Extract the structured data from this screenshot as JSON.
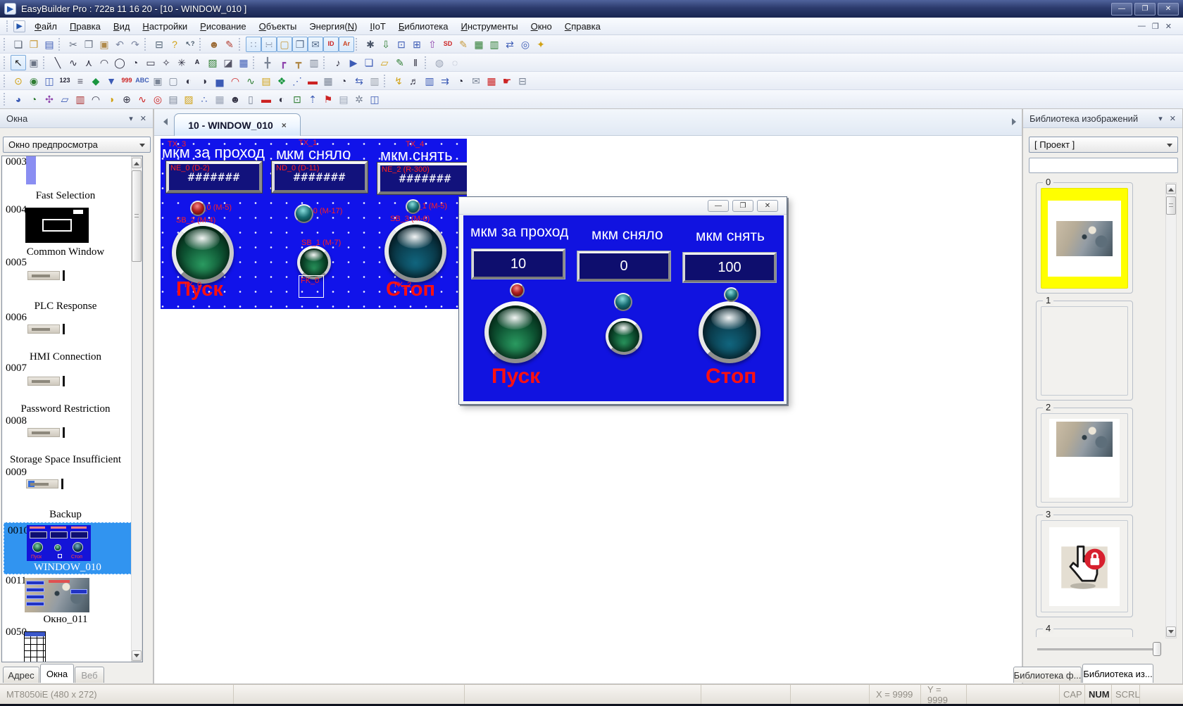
{
  "titlebar": {
    "title": "EasyBuilder Pro : 722в 11 16 20 - [10 - WINDOW_010 ]",
    "icon_glyph": "▶",
    "controls": [
      {
        "n": "minimize-button",
        "g": "—"
      },
      {
        "n": "maximize-button",
        "g": "❐"
      },
      {
        "n": "close-button",
        "g": "✕"
      }
    ]
  },
  "menu": {
    "items": [
      {
        "n": "menu-item-file",
        "label": "Файл",
        "u": 0
      },
      {
        "n": "menu-item-edit",
        "label": "Правка",
        "u": 0
      },
      {
        "n": "menu-item-view",
        "label": "Вид",
        "u": 0
      },
      {
        "n": "menu-item-options",
        "label": "Настройки",
        "u": 0
      },
      {
        "n": "menu-item-draw",
        "label": "Рисование",
        "u": 0
      },
      {
        "n": "menu-item-objects",
        "label": "Объекты",
        "u": 0
      },
      {
        "n": "menu-item-energy",
        "label": "Энергия(N)",
        "u": 8
      },
      {
        "n": "menu-item-iiot",
        "label": "IIoT",
        "u": 0
      },
      {
        "n": "menu-item-library",
        "label": "Библиотека",
        "u": 0
      },
      {
        "n": "menu-item-tools",
        "label": "Инструменты",
        "u": 0
      },
      {
        "n": "menu-item-window",
        "label": "Окно",
        "u": 0
      },
      {
        "n": "menu-item-help",
        "label": "Справка",
        "u": 0
      }
    ],
    "mdi": [
      {
        "n": "mdi-minimize-button",
        "g": "—"
      },
      {
        "n": "mdi-restore-button",
        "g": "❐"
      },
      {
        "n": "mdi-close-button",
        "g": "✕"
      }
    ]
  },
  "toolbars": {
    "row1": [
      {
        "n": "toolbar-grip",
        "g": "",
        "cls": "grip",
        "int": "false"
      },
      {
        "n": "new-button",
        "g": "❏",
        "c": "#555e6e"
      },
      {
        "n": "open-button",
        "g": "❒",
        "c": "#c79a3d"
      },
      {
        "n": "save-button",
        "g": "▤",
        "c": "#3c5bb5"
      },
      {
        "n": "toolbar-grip",
        "g": "",
        "cls": "grip",
        "int": "false"
      },
      {
        "n": "cut-button",
        "g": "✂",
        "c": "#6b7485"
      },
      {
        "n": "copy-button",
        "g": "❐",
        "c": "#6b7485"
      },
      {
        "n": "paste-button",
        "g": "▣",
        "c": "#b08a4a"
      },
      {
        "n": "undo-button",
        "g": "↶",
        "c": "#7b85a0"
      },
      {
        "n": "redo-button",
        "g": "↷",
        "c": "#7b85a0"
      },
      {
        "n": "toolbar-grip",
        "g": "",
        "cls": "grip",
        "int": "false"
      },
      {
        "n": "print-button",
        "g": "⊟",
        "c": "#556677"
      },
      {
        "n": "about-button",
        "g": "?",
        "c": "#d1a216"
      },
      {
        "n": "context-help-button",
        "g": "↖?",
        "c": "#445566",
        "cls": "txt"
      },
      {
        "n": "toolbar-grip",
        "g": "",
        "cls": "grip",
        "int": "false"
      },
      {
        "n": "easy-watch-button",
        "g": "☻",
        "c": "#9a6a35"
      },
      {
        "n": "pen-button",
        "g": "✎",
        "c": "#b23b2e"
      },
      {
        "n": "toolbar-grip",
        "g": "",
        "cls": "grip",
        "int": "false"
      },
      {
        "n": "grid-toggle",
        "g": "∷",
        "c": "#8a97ad",
        "cls": "act"
      },
      {
        "n": "snap-toggle",
        "g": "∺",
        "c": "#8a97ad",
        "cls": "act"
      },
      {
        "n": "window-settings-toggle",
        "g": "▢",
        "c": "#c79a3d",
        "cls": "act"
      },
      {
        "n": "display-overlap-toggle",
        "g": "❐",
        "c": "#566d8c",
        "cls": "act"
      },
      {
        "n": "address-tag-toggle",
        "g": "✉",
        "c": "#566d8c",
        "cls": "act"
      },
      {
        "n": "object-id-toggle",
        "g": "ID",
        "c": "#cc2222",
        "cls": "act txt"
      },
      {
        "n": "font-adjust-toggle",
        "g": "Ar",
        "c": "#cc4422",
        "cls": "act txt"
      },
      {
        "n": "toolbar-grip",
        "g": "",
        "cls": "grip",
        "int": "false"
      },
      {
        "n": "compile-button",
        "g": "✱",
        "c": "#4a5568"
      },
      {
        "n": "download-button",
        "g": "⇩",
        "c": "#2e7d32"
      },
      {
        "n": "offline-simulation-button",
        "g": "⊡",
        "c": "#3c5bb5"
      },
      {
        "n": "online-simulation-button",
        "g": "⊞",
        "c": "#3c5bb5"
      },
      {
        "n": "upload-button",
        "g": "⇧",
        "c": "#8e44ad"
      },
      {
        "n": "sd-download-button",
        "g": "SD",
        "c": "#cc2222",
        "cls": "txt"
      },
      {
        "n": "recipe-editor-button",
        "g": "✎",
        "c": "#c79a3d"
      },
      {
        "n": "recipe-database-button",
        "g": "▦",
        "c": "#2e7d32"
      },
      {
        "n": "table-edit-button",
        "g": "▥",
        "c": "#2e7d32"
      },
      {
        "n": "pass-through-button",
        "g": "⇄",
        "c": "#3c5bb5"
      },
      {
        "n": "system-information-button",
        "g": "◎",
        "c": "#3c5bb5"
      },
      {
        "n": "utility-manager-button",
        "g": "✦",
        "c": "#d1a216"
      }
    ],
    "row2": [
      {
        "n": "toolbar-grip",
        "g": "",
        "cls": "grip",
        "int": "false"
      },
      {
        "n": "select-tool",
        "g": "↖",
        "c": "#222222",
        "cls": "act"
      },
      {
        "n": "object-properties-button",
        "g": "▣",
        "c": "#6b7485"
      },
      {
        "n": "toolbar-grip",
        "g": "",
        "cls": "grip",
        "int": "false"
      },
      {
        "n": "line-tool",
        "g": "╲",
        "c": "#333344"
      },
      {
        "n": "curve-tool",
        "g": "∿",
        "c": "#333344"
      },
      {
        "n": "polyline-tool",
        "g": "⋏",
        "c": "#333344"
      },
      {
        "n": "arc-tool",
        "g": "◠",
        "c": "#333344"
      },
      {
        "n": "ellipse-tool",
        "g": "◯",
        "c": "#333344"
      },
      {
        "n": "pie-tool",
        "g": "◔",
        "c": "#333344"
      },
      {
        "n": "rectangle-tool",
        "g": "▭",
        "c": "#333344"
      },
      {
        "n": "polygon-tool",
        "g": "✧",
        "c": "#333344"
      },
      {
        "n": "burst-tool",
        "g": "✳",
        "c": "#333344"
      },
      {
        "n": "text-tool",
        "g": "A",
        "c": "#222233",
        "cls": "txt"
      },
      {
        "n": "picture-tool",
        "g": "▨",
        "c": "#2e7d32"
      },
      {
        "n": "shape-tool",
        "g": "◪",
        "c": "#555566"
      },
      {
        "n": "table-tool",
        "g": "▦",
        "c": "#3c5bb5"
      },
      {
        "n": "toolbar-grip",
        "g": "",
        "cls": "grip",
        "int": "false"
      },
      {
        "n": "pipe-straight-tool",
        "g": "╋",
        "c": "#7b8596"
      },
      {
        "n": "pipe-elbow-tool",
        "g": "┏",
        "c": "#8e44ad"
      },
      {
        "n": "pipe-tee-tool",
        "g": "┳",
        "c": "#b08a4a"
      },
      {
        "n": "pipe-cabinet-tool",
        "g": "▥",
        "c": "#7b8596"
      },
      {
        "n": "toolbar-grip",
        "g": "",
        "cls": "grip",
        "int": "false"
      },
      {
        "n": "sound-object-button",
        "g": "♪",
        "c": "#333344"
      },
      {
        "n": "media-object-button",
        "g": "▶",
        "c": "#3c5bb5"
      },
      {
        "n": "stack-object-button",
        "g": "❏",
        "c": "#3c5bb5"
      },
      {
        "n": "tag-object-button",
        "g": "▱",
        "c": "#d1a216"
      },
      {
        "n": "string-table-button",
        "g": "✎",
        "c": "#2e7d32"
      },
      {
        "n": "barcode-object-button",
        "g": "‖",
        "c": "#222233"
      },
      {
        "n": "toolbar-grip",
        "g": "",
        "cls": "grip",
        "int": "false"
      },
      {
        "n": "group-button",
        "g": "◍",
        "c": "#9aa3b5"
      },
      {
        "n": "ungroup-button",
        "g": "◌",
        "c": "#9aa3b5"
      }
    ],
    "row3": [
      {
        "n": "toolbar-grip",
        "g": "",
        "cls": "grip",
        "int": "false"
      },
      {
        "n": "bit-lamp-button",
        "g": "⊙",
        "c": "#d1a216"
      },
      {
        "n": "word-lamp-button",
        "g": "◉",
        "c": "#2e7d32"
      },
      {
        "n": "set-bit-button",
        "g": "◫",
        "c": "#3c5bb5"
      },
      {
        "n": "set-word-button",
        "g": "123",
        "c": "#222233",
        "cls": "txt"
      },
      {
        "n": "function-key-button",
        "g": "≡",
        "c": "#555566"
      },
      {
        "n": "toggle-switch-button",
        "g": "◆",
        "c": "#19963f"
      },
      {
        "n": "combo-button",
        "g": "▼",
        "c": "#3c5bb5"
      },
      {
        "n": "numeric-object-button",
        "g": "999",
        "c": "#cc2222",
        "cls": "txt"
      },
      {
        "n": "ascii-object-button",
        "g": "ABC",
        "c": "#3c5bb5",
        "cls": "txt"
      },
      {
        "n": "indirect-window-button",
        "g": "▣",
        "c": "#7b8596"
      },
      {
        "n": "direct-window-button",
        "g": "▢",
        "c": "#7b8596"
      },
      {
        "n": "moving-shape-button",
        "g": "◐",
        "c": "#333344"
      },
      {
        "n": "animation-button",
        "g": "◑",
        "c": "#333344"
      },
      {
        "n": "bar-graph-button",
        "g": "▅",
        "c": "#3c5bb5"
      },
      {
        "n": "meter-display-button",
        "g": "◠",
        "c": "#cc2222"
      },
      {
        "n": "trend-display-button",
        "g": "∿",
        "c": "#2e7d32"
      },
      {
        "n": "history-data-button",
        "g": "▤",
        "c": "#d1a216"
      },
      {
        "n": "data-block-button",
        "g": "❖",
        "c": "#19963f"
      },
      {
        "n": "xy-plot-button",
        "g": "⋰",
        "c": "#3c5bb5"
      },
      {
        "n": "alarm-bar-button",
        "g": "▬",
        "c": "#cc2222"
      },
      {
        "n": "alarm-display-button",
        "g": "▦",
        "c": "#7b8596"
      },
      {
        "n": "event-display-button",
        "g": "◔",
        "c": "#333344"
      },
      {
        "n": "data-transfer-button",
        "g": "⇆",
        "c": "#3c5bb5"
      },
      {
        "n": "recipe-view-button",
        "g": "▥",
        "c": "#99a0aa"
      },
      {
        "n": "toolbar-grip",
        "g": "",
        "cls": "grip",
        "int": "false"
      },
      {
        "n": "backup-object-button",
        "g": "↯",
        "c": "#d1a216"
      },
      {
        "n": "media-player-button",
        "g": "♬",
        "c": "#333344"
      },
      {
        "n": "data-sampling-button",
        "g": "▥",
        "c": "#3c5bb5"
      },
      {
        "n": "plc-control-button",
        "g": "⇉",
        "c": "#3c5bb5"
      },
      {
        "n": "scheduler-button",
        "g": "◔",
        "c": "#222233"
      },
      {
        "n": "email-button",
        "g": "✉",
        "c": "#7b8596"
      },
      {
        "n": "calendar-button",
        "g": "▦",
        "c": "#cc2222"
      },
      {
        "n": "touch-gesture-button",
        "g": "☛",
        "c": "#cc2222"
      },
      {
        "n": "printer-object-button",
        "g": "⊟",
        "c": "#7b8596"
      }
    ],
    "row4": [
      {
        "n": "toolbar-grip",
        "g": "",
        "cls": "grip",
        "int": "false"
      },
      {
        "n": "pie-chart-button",
        "g": "◕",
        "c": "#3c5bb5"
      },
      {
        "n": "circular-trend-button",
        "g": "◔",
        "c": "#2e7d32"
      },
      {
        "n": "fan-chart-button",
        "g": "✣",
        "c": "#8e44ad"
      },
      {
        "n": "flow-block-button",
        "g": "▱",
        "c": "#3c5bb5"
      },
      {
        "n": "resource-list-button",
        "g": "▥",
        "c": "#aa3333"
      },
      {
        "n": "gauge-button",
        "g": "◠",
        "c": "#333344"
      },
      {
        "n": "color-pie-button",
        "g": "◑",
        "c": "#d1a216"
      },
      {
        "n": "clock-object-button",
        "g": "⊕",
        "c": "#333344"
      },
      {
        "n": "trend-curve-button",
        "g": "∿",
        "c": "#cc2222"
      },
      {
        "n": "target-button",
        "g": "◎",
        "c": "#cc2222"
      },
      {
        "n": "schedule-table-button",
        "g": "▤",
        "c": "#7b8596"
      },
      {
        "n": "picture-viewer-button",
        "g": "▨",
        "c": "#d1a216"
      },
      {
        "n": "scatter-plot-button",
        "g": "∴",
        "c": "#3c5bb5"
      },
      {
        "n": "grid-object-button",
        "g": "▦",
        "c": "#9aa3b5"
      },
      {
        "n": "operator-panel-button",
        "g": "☻",
        "c": "#333344"
      },
      {
        "n": "door-object-button",
        "g": "▯",
        "c": "#7b8596"
      },
      {
        "n": "status-pill-button",
        "g": "▬",
        "c": "#cc2222"
      },
      {
        "n": "timer-object-button",
        "g": "◐",
        "c": "#333344"
      },
      {
        "n": "monitor-clock-button",
        "g": "⊡",
        "c": "#2e7d32"
      },
      {
        "n": "tag-up-button",
        "g": "⇡",
        "c": "#3c5bb5"
      },
      {
        "n": "flag-object-button",
        "g": "⚑",
        "c": "#cc2222"
      },
      {
        "n": "document-object-button",
        "g": "▤",
        "c": "#9aa3b5"
      },
      {
        "n": "gear-object-button",
        "g": "✲",
        "c": "#7b8596"
      },
      {
        "n": "monitor-flag-button",
        "g": "◫",
        "c": "#3c5bb5"
      }
    ]
  },
  "panel": {
    "collapse": "▾",
    "close": "✕"
  },
  "sidebar": {
    "title": "Окна",
    "preview_combo": "Окно предпросмотра",
    "items": [
      {
        "num": "0003",
        "label": "Fast Selection"
      },
      {
        "num": "0004",
        "label": "Common Window"
      },
      {
        "num": "0005",
        "label": "PLC Response"
      },
      {
        "num": "0006",
        "label": "HMI Connection"
      },
      {
        "num": "0007",
        "label": "Password Restriction"
      },
      {
        "num": "0008",
        "label": "Storage Space Insufficient"
      },
      {
        "num": "0009",
        "label": "Backup"
      },
      {
        "num": "0010",
        "label": "WINDOW_010"
      },
      {
        "num": "0011",
        "label": "Окно_011"
      },
      {
        "num": "0050",
        "label": ""
      }
    ],
    "tabs": [
      {
        "label": "Адрес"
      },
      {
        "label": "Окна"
      },
      {
        "label": "Веб"
      }
    ]
  },
  "canvas": {
    "tab": "10 - WINDOW_010",
    "close": "×"
  },
  "screen": {
    "headers": [
      {
        "tag": "TX_3",
        "text": "мкм за проход"
      },
      {
        "tag": "TX_1",
        "text": "мкм сняло"
      },
      {
        "tag": "TX_4",
        "text": "мкм снять"
      }
    ],
    "displays": [
      {
        "tag": "NE_0 (D-2)",
        "value": "#######"
      },
      {
        "tag": "ND_0 (D-11)",
        "value": "#######"
      },
      {
        "tag": "NE_2 (R-300)",
        "value": "#######"
      }
    ],
    "lamps": [
      {
        "tag": "BL_0 (M-5)"
      },
      {
        "tag": "SB_0 (M-17)"
      },
      {
        "tag": "BL_1 (M-5)"
      }
    ],
    "buttons": [
      {
        "tag": "SB_2 (M-4)"
      },
      {
        "tag": "SB_1 (M-7)"
      },
      {
        "tag": "SB_3 (M-6)"
      }
    ],
    "function_key": {
      "tag": "FK_0"
    },
    "captions": [
      {
        "tag": "TX_0",
        "text": "Пуск"
      },
      {
        "tag": "TX_2",
        "text": "Стоп"
      }
    ]
  },
  "sim_window": {
    "controls": [
      {
        "n": "sim-minimize-button",
        "g": "—"
      },
      {
        "n": "sim-restore-button",
        "g": "❐"
      },
      {
        "n": "sim-close-button",
        "g": "✕"
      }
    ],
    "headers": [
      "мкм за проход",
      "мкм сняло",
      "мкм снять"
    ],
    "values": [
      "10",
      "0",
      "100"
    ],
    "captions": [
      "Пуск",
      "Стоп"
    ]
  },
  "library": {
    "title": "Библиотека изображений",
    "combo": "[ Проект ]",
    "items": [
      {
        "idx": "0"
      },
      {
        "idx": "1"
      },
      {
        "idx": "2"
      },
      {
        "idx": "3"
      },
      {
        "idx": "4"
      }
    ],
    "tabs": [
      {
        "label": "Библиотека ф..."
      },
      {
        "label": "Библиотека из..."
      }
    ]
  },
  "statusbar": {
    "device": "MT8050iE (480 x 272)",
    "x": "X = 9999",
    "y": "Y = 9999",
    "cap": "CAP",
    "num": "NUM",
    "scrl": "SCRL"
  },
  "colors": {
    "screen_blue": "#1113ea",
    "selection_blue": "#3194f0",
    "selection_yellow": "#ffff00",
    "label_red": "#ff2020"
  }
}
